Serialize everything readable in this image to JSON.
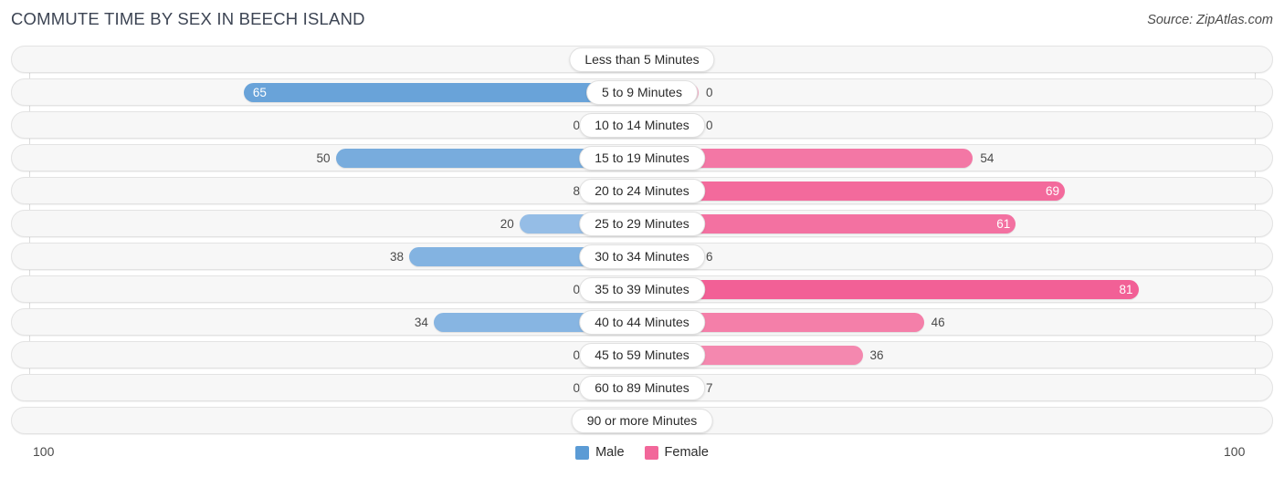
{
  "header": {
    "title": "COMMUTE TIME BY SEX IN BEECH ISLAND",
    "source": "Source: ZipAtlas.com"
  },
  "axis": {
    "left_label": "100",
    "right_label": "100"
  },
  "legend": {
    "items": [
      {
        "label": "Male",
        "color": "#5b9bd5"
      },
      {
        "label": "Female",
        "color": "#f2679a"
      }
    ]
  },
  "chart_data": {
    "type": "bar",
    "title": "COMMUTE TIME BY SEX IN BEECH ISLAND",
    "subtitle": "",
    "orientation": "horizontal-diverging",
    "xlabel": "",
    "ylabel": "",
    "xlim": [
      -100,
      100
    ],
    "axis_max": 100,
    "grid": false,
    "legend_position": "bottom-center",
    "categories": [
      "Less than 5 Minutes",
      "5 to 9 Minutes",
      "10 to 14 Minutes",
      "15 to 19 Minutes",
      "20 to 24 Minutes",
      "25 to 29 Minutes",
      "30 to 34 Minutes",
      "35 to 39 Minutes",
      "40 to 44 Minutes",
      "45 to 59 Minutes",
      "60 to 89 Minutes",
      "90 or more Minutes"
    ],
    "series": [
      {
        "name": "Male",
        "side": "left",
        "color": "#5b9bd5",
        "values": [
          0,
          65,
          0,
          50,
          8,
          20,
          38,
          0,
          34,
          0,
          0,
          0
        ]
      },
      {
        "name": "Female",
        "side": "right",
        "color": "#f2679a",
        "values": [
          0,
          0,
          0,
          54,
          69,
          61,
          6,
          81,
          46,
          36,
          7,
          0
        ]
      }
    ]
  },
  "rows": [
    {
      "label": "Less than 5 Minutes",
      "male": 0,
      "female": 0
    },
    {
      "label": "5 to 9 Minutes",
      "male": 65,
      "female": 0
    },
    {
      "label": "10 to 14 Minutes",
      "male": 0,
      "female": 0
    },
    {
      "label": "15 to 19 Minutes",
      "male": 50,
      "female": 54
    },
    {
      "label": "20 to 24 Minutes",
      "male": 8,
      "female": 69
    },
    {
      "label": "25 to 29 Minutes",
      "male": 20,
      "female": 61
    },
    {
      "label": "30 to 34 Minutes",
      "male": 38,
      "female": 6
    },
    {
      "label": "35 to 39 Minutes",
      "male": 0,
      "female": 81
    },
    {
      "label": "40 to 44 Minutes",
      "male": 34,
      "female": 46
    },
    {
      "label": "45 to 59 Minutes",
      "male": 0,
      "female": 36
    },
    {
      "label": "60 to 89 Minutes",
      "male": 0,
      "female": 7
    },
    {
      "label": "90 or more Minutes",
      "male": 0,
      "female": 0
    }
  ]
}
